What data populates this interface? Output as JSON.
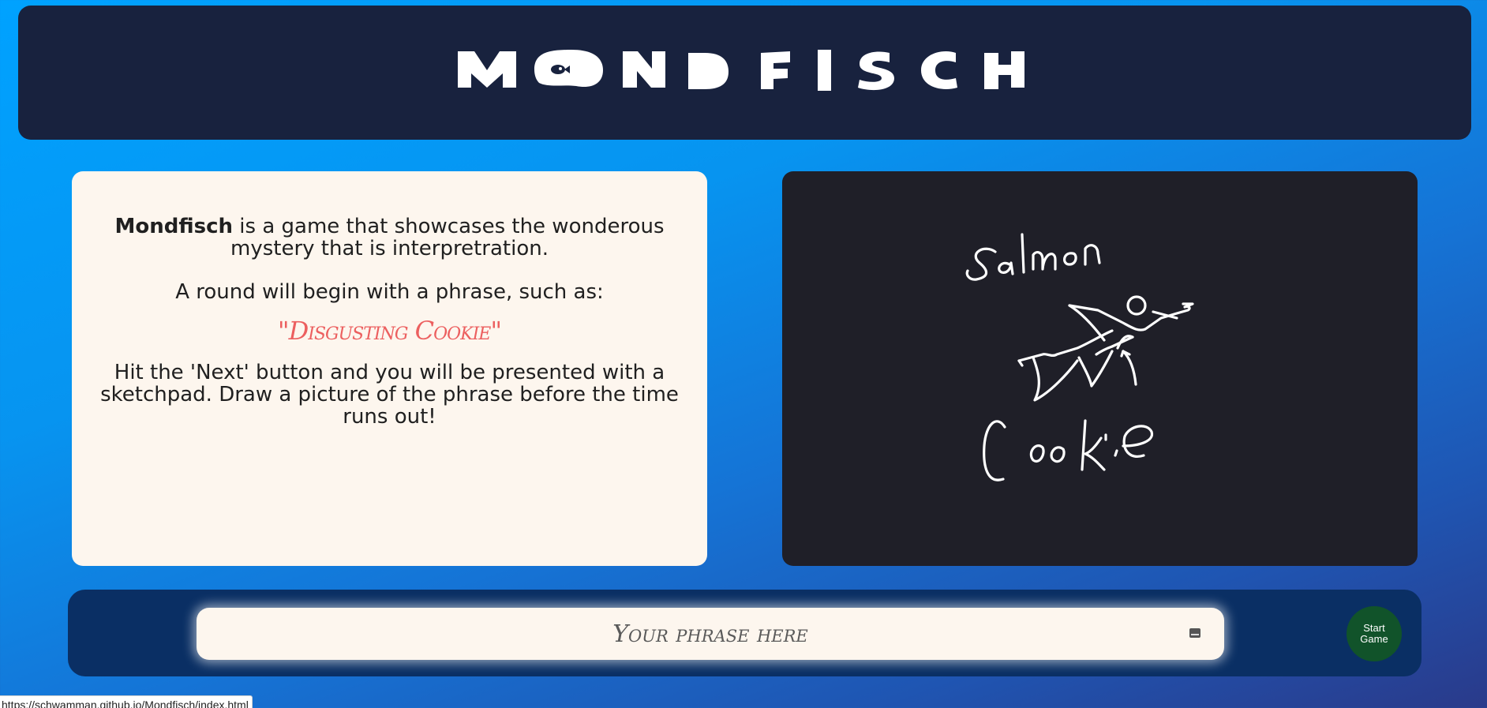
{
  "header": {
    "logo_text": "MONDFISCH"
  },
  "info": {
    "intro_bold": "Mondfisch",
    "intro_rest": " is a game that showcases the wonderous mystery that is interpretration.",
    "round_text": "A round will begin with a phrase, such as:",
    "example_phrase": "\"Disgusting Cookie\"",
    "instructions": "Hit the 'Next' button and you will be presented with a sketchpad. Draw a picture of the phrase before the time runs out!"
  },
  "sketch": {
    "handwritten_words": [
      "Salmon",
      "Cookie"
    ]
  },
  "input": {
    "placeholder": "Your phrase here",
    "value": ""
  },
  "buttons": {
    "start_label": "Start Game"
  },
  "status_bar": {
    "url": "https://schwamman.github.io/Mondfisch/index.html"
  },
  "colors": {
    "header_bg": "#18223e",
    "card_bg": "#fdf6ee",
    "sketch_bg": "#1f1f28",
    "accent_phrase": "#ec5f5f",
    "bottom_bar_bg": "#0a2f64",
    "start_button_bg": "#11532a"
  }
}
